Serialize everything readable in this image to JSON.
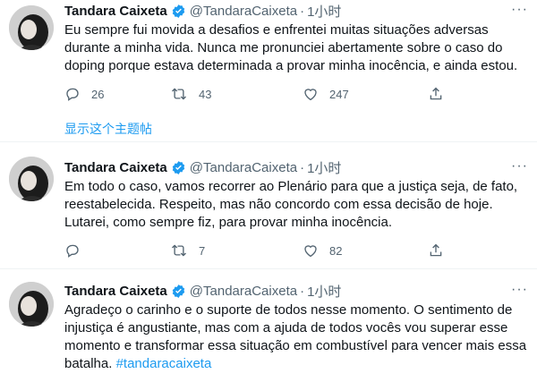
{
  "colors": {
    "link": "#1d9bf0",
    "muted": "#536471",
    "text": "#0f1419",
    "verified": "#1d9bf0"
  },
  "tweets": [
    {
      "author": "Tandara Caixeta",
      "handle": "@TandaraCaixeta",
      "separator": "·",
      "time": "1小时",
      "text": "Eu sempre fui movida a desafios e enfrentei muitas situações adversas durante a minha vida. Nunca me pronunciei abertamente sobre o caso do doping porque estava determinada a provar minha inocência, e ainda estou.",
      "replies": "26",
      "retweets": "43",
      "likes": "247",
      "thread_link": "显示这个主题帖"
    },
    {
      "author": "Tandara Caixeta",
      "handle": "@TandaraCaixeta",
      "separator": "·",
      "time": "1小时",
      "text": "Em todo o caso, vamos recorrer ao Plenário para que a justiça seja, de fato, reestabelecida. Respeito, mas não concordo com essa decisão de hoje. Lutarei, como sempre fiz, para provar minha inocência.",
      "replies": "",
      "retweets": "7",
      "likes": "82"
    },
    {
      "author": "Tandara Caixeta",
      "handle": "@TandaraCaixeta",
      "separator": "·",
      "time": "1小时",
      "text": "Agradeço o carinho e o suporte de todos nesse momento. O sentimento de injustiça é angustiante, mas com a ajuda de todos vocês vou superar esse momento e transformar essa situação em combustível para vencer mais essa batalha.",
      "hashtag": "#tandaracaixeta"
    }
  ],
  "icons": {
    "verified": "verified-badge-icon",
    "more": "more-options-icon",
    "reply": "reply-icon",
    "retweet": "retweet-icon",
    "like": "like-icon",
    "share": "share-icon"
  }
}
